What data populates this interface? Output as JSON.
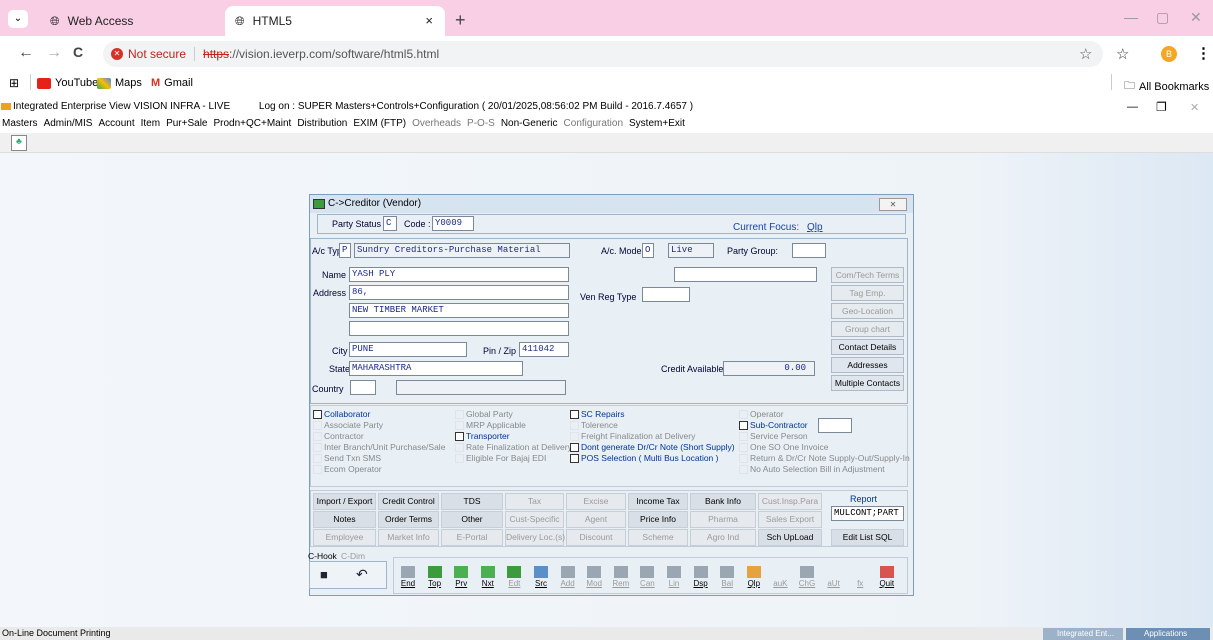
{
  "browser": {
    "tabs": [
      {
        "title": "Web Access",
        "close": "×"
      },
      {
        "title": "HTML5",
        "close": "×"
      }
    ],
    "new_tab": "+",
    "back": "←",
    "forward": "→",
    "reload": "C",
    "not_secure": "Not secure",
    "url_scheme": "https",
    "url_rest": "://vision.ieverp.com/software/html5.html",
    "star": "☆",
    "extension_star": "☆",
    "profile_initial": "B",
    "menu": "⋮",
    "win_min": "—",
    "win_max": "▢",
    "win_close": "✕",
    "bookmarks": [
      "YouTube",
      "Maps",
      "Gmail"
    ],
    "all_bookmarks": "All Bookmarks"
  },
  "app": {
    "title": "Integrated Enterprise View VISION INFRA - LIVE",
    "logon": "Log on : SUPER  Masters+Controls+Configuration ( 20/01/2025,08:56:02 PM Build - 2016.7.4657 )",
    "menu": [
      {
        "label": "Masters",
        "dim": false
      },
      {
        "label": "Admin/MIS",
        "dim": false
      },
      {
        "label": "Account",
        "dim": false
      },
      {
        "label": "Item",
        "dim": false
      },
      {
        "label": "Pur+Sale",
        "dim": false
      },
      {
        "label": "Prodn+QC+Maint",
        "dim": false
      },
      {
        "label": "Distribution",
        "dim": false
      },
      {
        "label": "EXIM (FTP)",
        "dim": false
      },
      {
        "label": "Overheads",
        "dim": true
      },
      {
        "label": "P-O-S",
        "dim": true
      },
      {
        "label": "Non-Generic",
        "dim": false
      },
      {
        "label": "Configuration",
        "dim": true
      },
      {
        "label": "System+Exit",
        "dim": false
      }
    ],
    "win_min": "—",
    "win_max": "❐",
    "win_close": "✕",
    "status": "On-Line Document Printing",
    "task1": "Integrated Ent...",
    "task2": "Applications"
  },
  "dialog": {
    "title": "C->Creditor (Vendor)",
    "close": "✕",
    "party_status_label": "Party Status :",
    "party_status": "C",
    "code_label": "Code :",
    "code": "Y0009",
    "current_focus_label": "Current Focus:",
    "current_focus": "Qlp",
    "ac_type_label": "A/c Type",
    "ac_type": "P",
    "ac_type_desc": "Sundry Creditors-Purchase Material",
    "ac_mode_label": "A/c. Mode:",
    "ac_mode": "O",
    "ac_mode_desc": "Live",
    "party_group_label": "Party Group:",
    "party_group": "",
    "name_label": "Name",
    "name": "YASH PLY",
    "address_label": "Address",
    "address": [
      "86,",
      "NEW TIMBER MARKET",
      ""
    ],
    "city_label": "City",
    "city": "PUNE",
    "pin_label": "Pin / Zip",
    "pin": "411042",
    "state_label": "State",
    "state": "MAHARASHTRA",
    "country_label": "Country",
    "country_code": "",
    "country": "",
    "ven_reg_label": "Ven Reg Type",
    "ven_reg": "",
    "extra_field": "",
    "credit_label": "Credit Available",
    "credit": "0.00",
    "side_buttons": [
      {
        "label": "Com/Tech Terms",
        "enabled": false
      },
      {
        "label": "Tag Emp.",
        "enabled": false
      },
      {
        "label": "Geo-Location",
        "enabled": false
      },
      {
        "label": "Group chart",
        "enabled": false
      },
      {
        "label": "Contact Details",
        "enabled": true
      },
      {
        "label": "Addresses",
        "enabled": true
      },
      {
        "label": "Multiple Contacts",
        "enabled": true
      }
    ],
    "checks_col1": [
      {
        "label": "Collaborator",
        "state": "blue"
      },
      {
        "label": "Associate Party",
        "state": "dis"
      },
      {
        "label": "Contractor",
        "state": "dis"
      },
      {
        "label": "Inter Branch/Unit Purchase/Sale",
        "state": "dis"
      },
      {
        "label": "Send Txn SMS",
        "state": "dis"
      },
      {
        "label": "Ecom Operator",
        "state": "dis"
      }
    ],
    "checks_col2": [
      {
        "label": "Global Party",
        "state": "dis"
      },
      {
        "label": "MRP Applicable",
        "state": "dis"
      },
      {
        "label": "Transporter",
        "state": "blue"
      },
      {
        "label": "Rate Finalization at Delivery",
        "state": "dis"
      },
      {
        "label": "Eligible For Bajaj EDI",
        "state": "dis"
      }
    ],
    "checks_col3": [
      {
        "label": "SC Repairs",
        "state": "blue"
      },
      {
        "label": "Tolerence",
        "state": "dis"
      },
      {
        "label": "Freight Finalization at Delivery",
        "state": "dis"
      },
      {
        "label": "Dont generate Dr/Cr Note (Short Supply)",
        "state": "blue"
      },
      {
        "label": "POS Selection ( Multi Bus Location )",
        "state": "blue"
      }
    ],
    "checks_col4": [
      {
        "label": "Operator",
        "state": "dis"
      },
      {
        "label": "Sub-Contractor",
        "state": "blue"
      },
      {
        "label": "Service Person",
        "state": "dis"
      },
      {
        "label": "One SO One Invoice",
        "state": "dis"
      },
      {
        "label": "Return & Dr/Cr Note Supply-Out/Supply-In",
        "state": "dis"
      },
      {
        "label": "No Auto Selection Bill in Adjustment",
        "state": "dis"
      }
    ],
    "sub_contractor_value": "",
    "grid_row1": [
      {
        "label": "Import / Export",
        "dis": false
      },
      {
        "label": "Credit Control",
        "dis": false
      },
      {
        "label": "TDS",
        "dis": false
      },
      {
        "label": "Tax",
        "dis": true
      },
      {
        "label": "Excise",
        "dis": true
      },
      {
        "label": "Income Tax",
        "dis": false
      },
      {
        "label": "Bank Info",
        "dis": false
      },
      {
        "label": "Cust.Insp.Para",
        "dis": true
      }
    ],
    "grid_row2": [
      {
        "label": "Notes",
        "dis": false
      },
      {
        "label": "Order Terms",
        "dis": false
      },
      {
        "label": "Other",
        "dis": false
      },
      {
        "label": "Cust-Specific",
        "dis": true
      },
      {
        "label": "Agent",
        "dis": true
      },
      {
        "label": "Price Info",
        "dis": false
      },
      {
        "label": "Pharma",
        "dis": true
      },
      {
        "label": "Sales Export",
        "dis": true
      }
    ],
    "grid_row3": [
      {
        "label": "Employee",
        "dis": true
      },
      {
        "label": "Market Info",
        "dis": true
      },
      {
        "label": "E-Portal",
        "dis": true
      },
      {
        "label": "Delivery Loc.(s)",
        "dis": true
      },
      {
        "label": "Discount",
        "dis": true
      },
      {
        "label": "Scheme",
        "dis": true
      },
      {
        "label": "Agro Ind",
        "dis": true
      },
      {
        "label": "Sch UpLoad",
        "dis": false
      }
    ],
    "report_label": "Report",
    "report_value": "MULCONT;PART",
    "edit_list_sql": "Edit List SQL",
    "hook_tabs": [
      "C-Hook",
      "C-Dim"
    ],
    "save_glyph": "■",
    "undo_glyph": "↶",
    "nav_buttons": [
      {
        "label": "End",
        "dis": false,
        "color": "#9aa6b2"
      },
      {
        "label": "Top",
        "dis": false,
        "color": "#3c9b3c"
      },
      {
        "label": "Prv",
        "dis": false,
        "color": "#4caf50"
      },
      {
        "label": "Nxt",
        "dis": false,
        "color": "#4caf50"
      },
      {
        "label": "Edt",
        "dis": true,
        "color": "#3c9b3c"
      },
      {
        "label": "Src",
        "dis": false,
        "color": "#5b8fc9"
      },
      {
        "label": "Add",
        "dis": true,
        "color": "#9aa6b2"
      },
      {
        "label": "Mod",
        "dis": true,
        "color": "#9aa6b2"
      },
      {
        "label": "Rem",
        "dis": true,
        "color": "#9aa6b2"
      },
      {
        "label": "Can",
        "dis": true,
        "color": "#9aa6b2"
      },
      {
        "label": "Lin",
        "dis": true,
        "color": "#9aa6b2"
      },
      {
        "label": "Dsp",
        "dis": false,
        "color": "#9aa6b2"
      },
      {
        "label": "Bal",
        "dis": true,
        "color": "#9aa6b2"
      },
      {
        "label": "Qlp",
        "dis": false,
        "color": "#e6a23c"
      },
      {
        "label": "auK",
        "dis": true,
        "color": "#e8f0f6"
      },
      {
        "label": "ChG",
        "dis": true,
        "color": "#9aa6b2"
      },
      {
        "label": "aUt",
        "dis": true,
        "color": "#e8f0f6"
      },
      {
        "label": "fx",
        "dis": true,
        "color": "#e8f0f6"
      },
      {
        "label": "Quit",
        "dis": false,
        "color": "#d9534f"
      }
    ]
  }
}
